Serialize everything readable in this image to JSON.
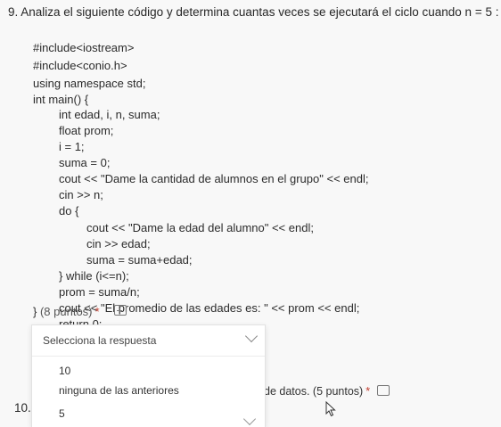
{
  "question9": {
    "title": "9. Analiza el siguiente código y determina cuantas veces se ejecutará el ciclo cuando n = 5 :",
    "code_lines": [
      "#include<iostream>",
      "#include<conio.h>",
      "using namespace std;",
      "int main() {",
      "int edad, i, n, suma;",
      "float prom;",
      "i = 1;",
      "suma = 0;",
      "cout << \"Dame la cantidad de alumnos en el grupo\" << endl;",
      "cin >> n;",
      "do {",
      "cout << \"Dame la edad del alumno\" << endl;",
      "cin >> edad;",
      "suma = suma+edad;",
      "} while (i<=n);",
      "prom = suma/n;",
      "cout << \"El promedio de las edades es: \" << prom << endl;",
      "return 0;",
      "}"
    ],
    "points_label": "(8 puntos)",
    "required_mark": "*"
  },
  "dropdown": {
    "placeholder": "Selecciona la respuesta",
    "options": [
      "10",
      "ninguna de las anteriores",
      "5"
    ]
  },
  "question10": {
    "number": "10.",
    "partial_text": "de datos. (5 puntos)",
    "required_mark": "*"
  }
}
